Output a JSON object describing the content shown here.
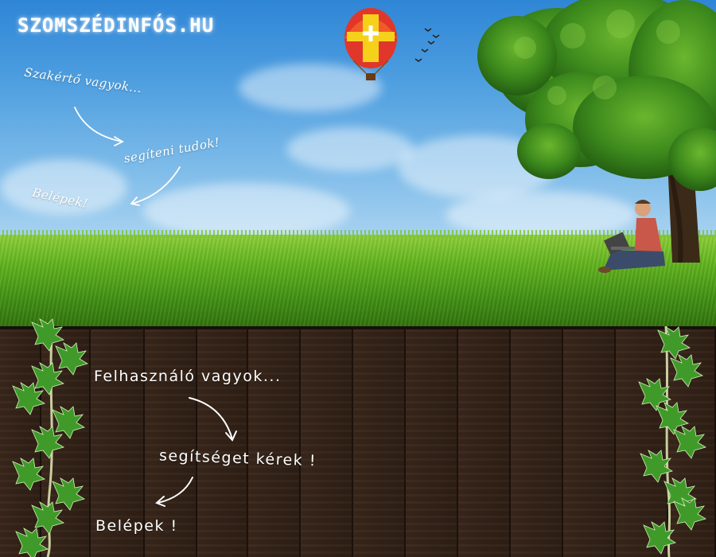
{
  "site": {
    "logo": "SZOMSZÉDINFÓS.HU"
  },
  "expert_section": {
    "line1": "Szakértő vagyok...",
    "line2": "segíteni tudok!",
    "login": "Belépek!"
  },
  "user_section": {
    "line1": "Felhasználó vagyok...",
    "line2": "segítséget kérek !",
    "login": "Belépek !"
  },
  "colors": {
    "sky": "#4f9fe0",
    "grass": "#63b51f",
    "fence": "#2a1b12",
    "ivy": "#3f9a2a"
  },
  "icons": [
    "hot-air-balloon-icon",
    "birds-icon",
    "tree-icon",
    "person-with-laptop-icon",
    "ivy-icon",
    "arrow-icon"
  ]
}
